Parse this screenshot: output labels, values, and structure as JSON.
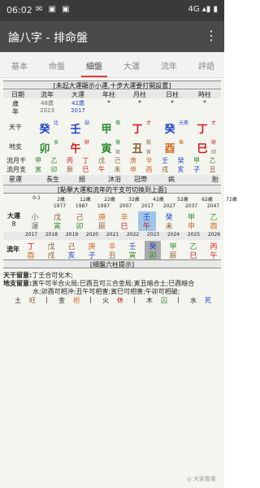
{
  "status": {
    "time": "06:02",
    "left_icons": "✉ ▣ ▣",
    "right_icons": "4G ▴▮ ▮"
  },
  "appbar": {
    "title": "論八字 - 排命盤",
    "menu_icon": "⋮"
  },
  "tabs": [
    "基本",
    "命盤",
    "細盤",
    "大運",
    "流年",
    "評語"
  ],
  "active_tab": 2,
  "banner1": "[未起大運顯示小運,十步大運要打開設置]",
  "header": [
    "日期",
    "流年",
    "大運",
    "年柱",
    "月柱",
    "日柱",
    "時柱"
  ],
  "age": {
    "label": "歲\n年",
    "liunian": [
      "48歲",
      "2023"
    ],
    "dayun": [
      "42歲",
      "2017"
    ],
    "stars": [
      "*",
      "*",
      "*",
      "*"
    ]
  },
  "tiangan": {
    "label": "天干",
    "cells": [
      {
        "char": "癸",
        "sup": "比",
        "cls": "c-blue"
      },
      {
        "char": "壬",
        "sup": "劫",
        "cls": "c-blue"
      },
      {
        "char": "甲",
        "sup": "傷",
        "cls": "c-green"
      },
      {
        "char": "丁",
        "sup": "才",
        "cls": "c-red"
      },
      {
        "char": "癸",
        "sup": "元男",
        "cls": "c-blue"
      },
      {
        "char": "丁",
        "sup": "才",
        "cls": "c-red"
      }
    ]
  },
  "dizhi": {
    "label": "地支",
    "cells": [
      {
        "char": "卯",
        "sup": "食",
        "cls": "c-green"
      },
      {
        "char": "午",
        "sup": "財",
        "cls": "c-red"
      },
      {
        "char": "寅",
        "sup": "傷",
        "sub": "官",
        "cls": "c-green"
      },
      {
        "char": "丑",
        "sup": "殺",
        "sub": "官",
        "cls": "c-brown"
      },
      {
        "char": "酉",
        "sup": "梟",
        "cls": "c-orange"
      },
      {
        "char": "巳",
        "sup": "財",
        "sub": "印",
        "cls": "c-red"
      }
    ]
  },
  "liuyue_gan": {
    "label": "流月干",
    "chars": [
      "甲",
      "乙",
      "丙",
      "丁",
      "戊",
      "己",
      "庚",
      "辛",
      "壬",
      "癸",
      "甲",
      "乙"
    ]
  },
  "liuyue_zhi": {
    "label": "流月支",
    "chars": [
      "寅",
      "卯",
      "辰",
      "巳",
      "午",
      "未",
      "申",
      "酉",
      "戌",
      "亥",
      "子",
      "丑"
    ]
  },
  "xingyun": {
    "label": "星運",
    "values": [
      "",
      "長生",
      "絕",
      "沐浴",
      "冠帶",
      "病",
      "",
      "",
      "胎"
    ]
  },
  "banner2": "[點擊大運和流年的干支可切換到上面]",
  "dayun_ages": [
    "0-1",
    "2歲",
    "12歲",
    "22歲",
    "32歲",
    "42歲",
    "52歲",
    "62歲",
    "72歲"
  ],
  "dayun_years": [
    "1977",
    "1987",
    "1997",
    "2007",
    "2017",
    "2027",
    "2037",
    "2047"
  ],
  "dayun_label": "大運\n8",
  "dayun_gan": [
    "小",
    "戊",
    "己",
    "庚",
    "辛",
    "壬",
    "癸",
    "甲",
    "乙"
  ],
  "dayun_zhi": [
    "運",
    "寅",
    "卯",
    "辰",
    "巳",
    "午",
    "未",
    "申",
    "酉"
  ],
  "liunian_years": [
    "2017",
    "2018",
    "2019",
    "2020",
    "2021",
    "2022",
    "2023",
    "2024",
    "2025",
    "2026"
  ],
  "liunian_label": "流年",
  "liunian_gan": [
    "丁",
    "戊",
    "己",
    "庚",
    "辛",
    "壬",
    "癸",
    "甲",
    "乙",
    "丙"
  ],
  "liunian_zhi": [
    "酉",
    "戌",
    "亥",
    "子",
    "丑",
    "寅",
    "卯",
    "辰",
    "巳",
    "午"
  ],
  "banner3": "[細盤六柱提示]",
  "notes": [
    {
      "label": "天干留意:",
      "text": "丁壬合可化木;"
    },
    {
      "label": "地支留意:",
      "text": "寅午可半合火局;巳酉丑可三合金局;寅丑暗合土;巳酉暗合"
    },
    {
      "label": "",
      "text": "水;卯酉可相沖;丑午可相害;寅巳可相害;午卯可相破;"
    }
  ],
  "wuxing": [
    {
      "elem": "土",
      "state": "旺",
      "cls": "c-brown"
    },
    {
      "elem": "金",
      "state": "相",
      "cls": "c-orange"
    },
    {
      "elem": "火",
      "state": "休",
      "cls": "c-red"
    },
    {
      "elem": "木",
      "state": "囚",
      "cls": "c-green"
    },
    {
      "elem": "水",
      "state": "死",
      "cls": "c-blue"
    }
  ],
  "watermark": "◎ 大家看看"
}
